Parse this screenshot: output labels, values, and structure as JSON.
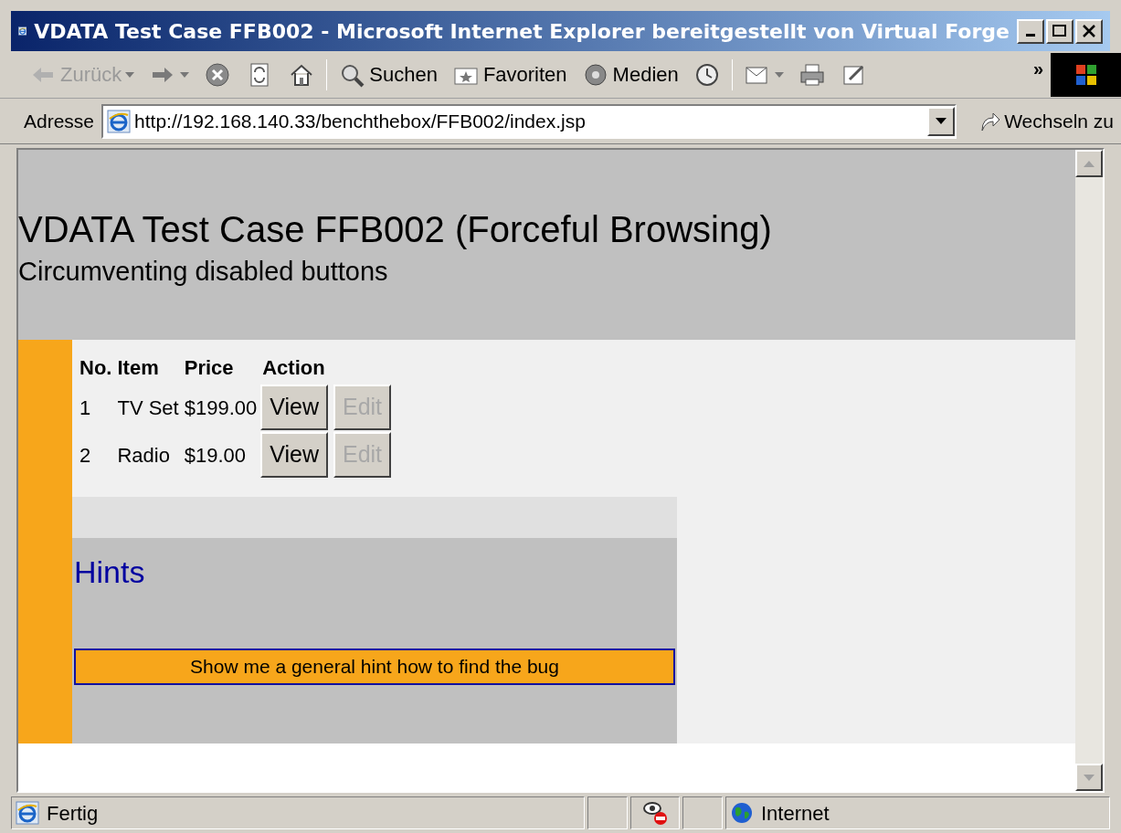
{
  "window": {
    "title": "VDATA Test Case FFB002 - Microsoft Internet Explorer bereitgestellt von Virtual Forge"
  },
  "toolbar": [
    {
      "kind": "back",
      "label": "Zurück",
      "disabled": true
    },
    {
      "kind": "forward"
    },
    {
      "kind": "stop"
    },
    {
      "kind": "refresh"
    },
    {
      "kind": "home"
    },
    {
      "kind": "search",
      "label": "Suchen"
    },
    {
      "kind": "favorites",
      "label": "Favoriten"
    },
    {
      "kind": "media",
      "label": "Medien"
    },
    {
      "kind": "history"
    },
    {
      "kind": "mail"
    },
    {
      "kind": "print"
    },
    {
      "kind": "edit"
    }
  ],
  "toolbar_more": "»",
  "address_bar": {
    "label": "Adresse",
    "value": "http://192.168.140.33/benchthebox/FFB002/index.jsp",
    "go": "Wechseln zu"
  },
  "page": {
    "title": "VDATA Test Case FFB002 (Forceful Browsing)",
    "subtitle": "Circumventing disabled buttons",
    "table": {
      "columns": [
        "No.",
        "Item",
        "Price",
        "Action"
      ],
      "rows": [
        {
          "no": "1",
          "item": "TV Set",
          "price": "$199.00",
          "buttons": [
            {
              "label": "View",
              "disabled": false
            },
            {
              "label": "Edit",
              "disabled": true
            }
          ]
        },
        {
          "no": "2",
          "item": "Radio",
          "price": "$19.00",
          "buttons": [
            {
              "label": "View",
              "disabled": false
            },
            {
              "label": "Edit",
              "disabled": true
            }
          ]
        }
      ]
    },
    "hints": {
      "title": "Hints",
      "button": "Show me a general hint how to find the bug"
    }
  },
  "status_bar": {
    "text": "Fertig",
    "zone": "Internet"
  }
}
